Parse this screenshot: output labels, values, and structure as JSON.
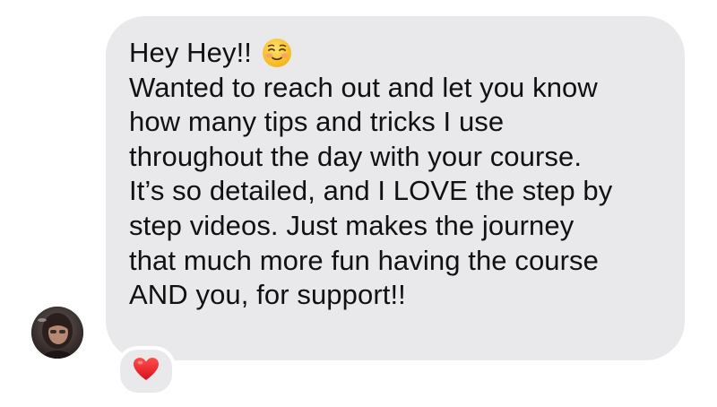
{
  "message": {
    "greeting": "Hey Hey!!",
    "greeting_emoji": "smiling-face-icon",
    "lines": [
      "Wanted to reach out and let you know",
      "how many tips and tricks I use",
      "throughout the day with your course.",
      "It’s so detailed, and I LOVE the step by",
      "step videos. Just makes the journey",
      "that much more fun having the course",
      "AND you, for support!!"
    ]
  },
  "reaction": {
    "icon": "heart-icon",
    "color": "#e0245e"
  },
  "sender": {
    "avatar_icon": "avatar"
  },
  "colors": {
    "bubble": "#e9e9eb",
    "text": "#111111",
    "background": "#ffffff"
  }
}
